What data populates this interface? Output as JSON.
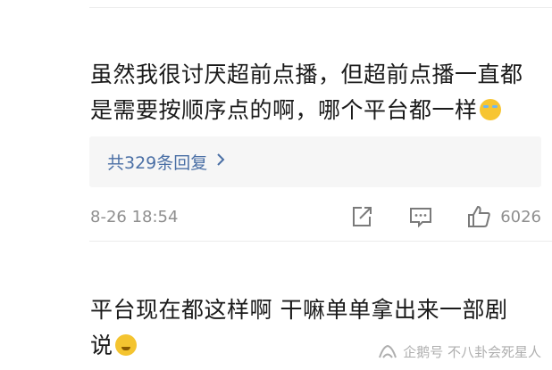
{
  "comments": [
    {
      "text_line1": "虽然我很讨厌超前点播，但超前点播一直都",
      "text_line2": "是需要按顺序点的啊，哪个平台都一样",
      "emoji": "laugh-cry-emoji",
      "replies_label": "共329条回复",
      "timestamp": "8-26 18:54",
      "like_count": "6026"
    },
    {
      "text_line1": "平台现在都这样啊   干嘛单单拿出来一部剧",
      "text_line2": "说",
      "emoji": "shrug-emoji"
    }
  ],
  "watermark": {
    "text": "企鹅号 不八卦会死星人"
  },
  "colors": {
    "text": "#1a1a1a",
    "meta": "#8f8f8f",
    "link": "#4a6fa5",
    "reply_bg": "#f6f6f6"
  }
}
